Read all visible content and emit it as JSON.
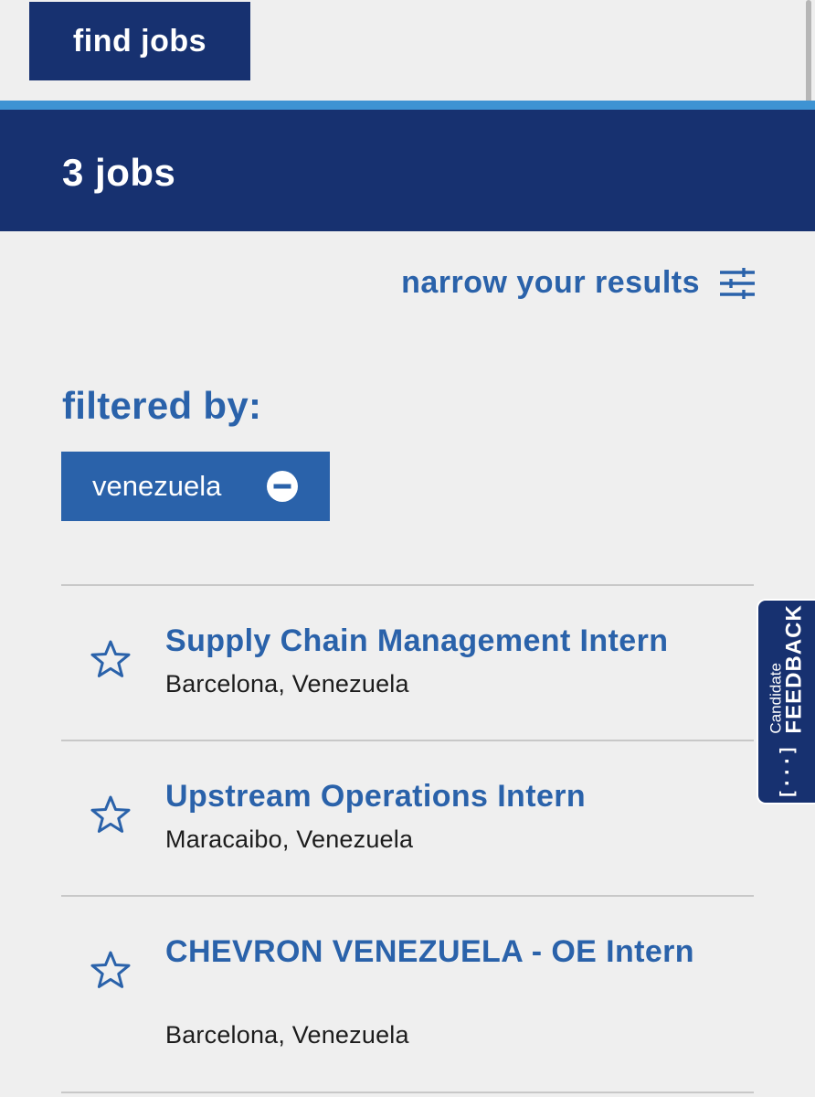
{
  "top_button": {
    "label": "find jobs"
  },
  "results_header": {
    "count_text": "3 jobs"
  },
  "narrow": {
    "label": "narrow your results",
    "icon": "sliders-icon"
  },
  "filters": {
    "label": "filtered by:",
    "chips": [
      {
        "label": "venezuela",
        "icon": "minus-circle-icon"
      }
    ]
  },
  "jobs": [
    {
      "title": "Supply Chain Management Intern",
      "location": "Barcelona, Venezuela"
    },
    {
      "title": "Upstream Operations Intern",
      "location": "Maracaibo, Venezuela"
    },
    {
      "title": "CHEVRON VENEZUELA - OE Intern",
      "location": "Barcelona, Venezuela"
    }
  ],
  "feedback_tab": {
    "small_label": "Candidate",
    "big_label": "FEEDBACK",
    "bracket": "[···]"
  },
  "colors": {
    "navy": "#173170",
    "accent_blue": "#2a62aa",
    "stripe_blue": "#3e93d3",
    "background": "#efefef"
  }
}
